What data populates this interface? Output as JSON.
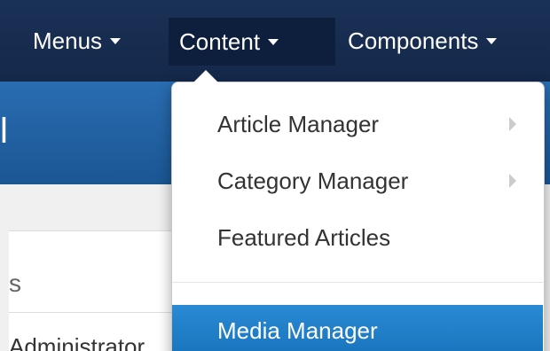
{
  "navbar": {
    "items": [
      {
        "label": "Menus"
      },
      {
        "label": "Content"
      },
      {
        "label": "Components"
      }
    ]
  },
  "header": {
    "title_fragment": "l"
  },
  "left_panel": {
    "heading_fragment": "s",
    "row_fragment": "Administrator"
  },
  "dropdown": {
    "items": [
      {
        "label": "Article Manager",
        "has_submenu": true
      },
      {
        "label": "Category Manager",
        "has_submenu": true
      },
      {
        "label": "Featured Articles",
        "has_submenu": false
      },
      {
        "label": "Media Manager",
        "has_submenu": false,
        "highlighted": true
      }
    ]
  },
  "colors": {
    "navbar_bg": "#172c4f",
    "active_nav_bg": "#0e1f3d",
    "header_bg": "#1d5a9a",
    "highlight_bg": "#1e7ec8"
  }
}
